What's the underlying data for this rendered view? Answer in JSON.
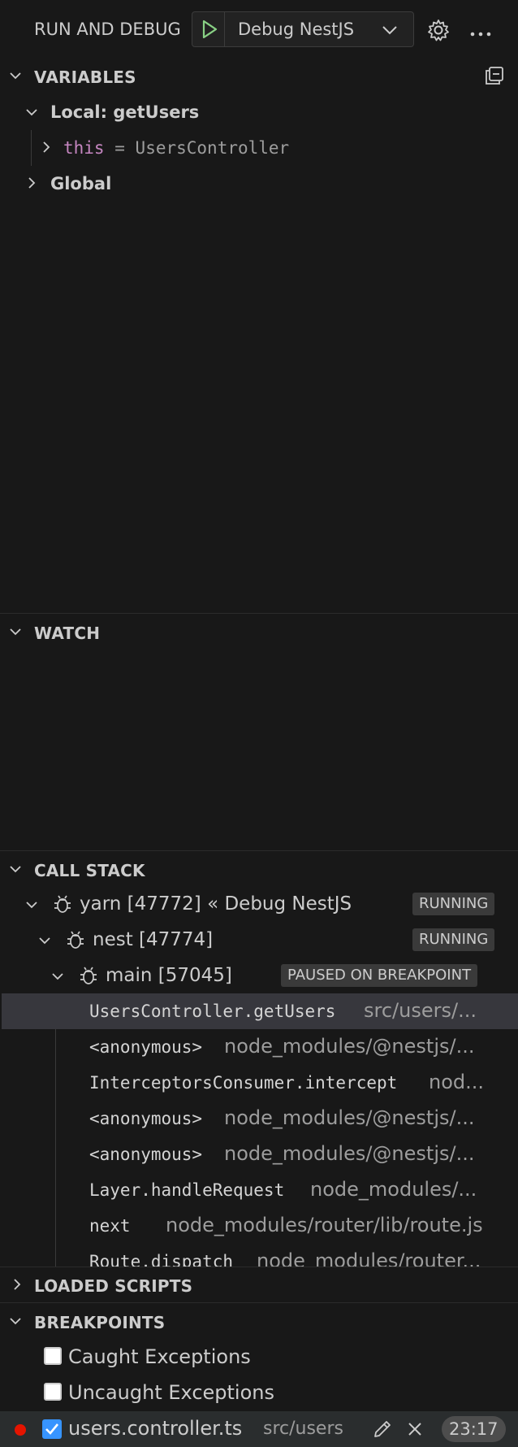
{
  "header": {
    "title": "RUN AND DEBUG",
    "config_name": "Debug NestJS"
  },
  "variables": {
    "title": "VARIABLES",
    "scope_local": "Local: getUsers",
    "this_name": "this",
    "this_eq": "=",
    "this_value": "UsersController",
    "scope_global": "Global"
  },
  "watch": {
    "title": "WATCH"
  },
  "call_stack": {
    "title": "CALL STACK",
    "threads": [
      {
        "label": "yarn [47772] « Debug NestJS",
        "status": "RUNNING"
      },
      {
        "label": "nest [47774]",
        "status": "RUNNING"
      },
      {
        "label": "main [57045]",
        "status": "PAUSED ON BREAKPOINT"
      }
    ],
    "frames": [
      {
        "fn": "UsersController.getUsers",
        "src": "src/users/..."
      },
      {
        "fn": "<anonymous>",
        "src": "node_modules/@nestjs/..."
      },
      {
        "fn": "InterceptorsConsumer.intercept",
        "src": "nod..."
      },
      {
        "fn": "<anonymous>",
        "src": "node_modules/@nestjs/..."
      },
      {
        "fn": "<anonymous>",
        "src": "node_modules/@nestjs/..."
      },
      {
        "fn": "Layer.handleRequest",
        "src": "node_modules/..."
      },
      {
        "fn": "next",
        "src": "node_modules/router/lib/route.js"
      },
      {
        "fn": "Route.dispatch",
        "src": "node_modules/router..."
      }
    ]
  },
  "loaded_scripts": {
    "title": "LOADED SCRIPTS"
  },
  "breakpoints": {
    "title": "BREAKPOINTS",
    "caught": "Caught Exceptions",
    "uncaught": "Uncaught Exceptions",
    "file": {
      "name": "users.controller.ts",
      "path": "src/users",
      "line": "23:17"
    }
  },
  "colors": {
    "background": "#181818",
    "accent_green": "#89d185",
    "breakpoint_red": "#e51400",
    "checkbox_blue": "#3794ff",
    "keyword_purple": "#c586c0"
  }
}
